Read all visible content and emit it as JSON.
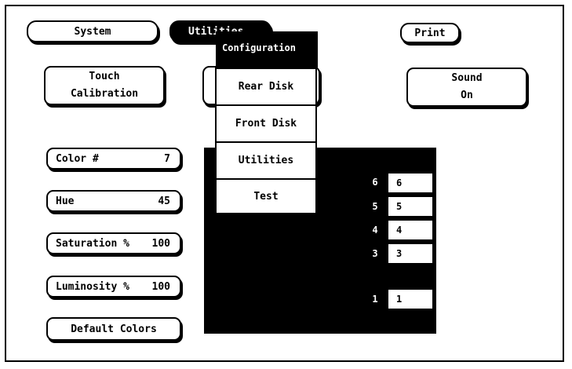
{
  "tabs": {
    "system": "System",
    "utilities": "Utilities",
    "print": "Print"
  },
  "buttons": {
    "touch_calibration": [
      "Touch",
      "Calibration"
    ],
    "rear_disk_hidden": "",
    "sound": [
      "Sound",
      "On"
    ],
    "color": {
      "label": "Color #",
      "value": "7"
    },
    "hue": {
      "label": "Hue",
      "value": "45"
    },
    "saturation": {
      "label": "Saturation %",
      "value": "100"
    },
    "luminosity": {
      "label": "Luminosity %",
      "value": "100"
    },
    "default_colors": "Default Colors"
  },
  "menu": {
    "title": "Configuration",
    "items": [
      "Rear Disk",
      "Front Disk",
      "Utilities",
      "Test"
    ]
  },
  "color_slots": [
    {
      "label": "6",
      "value": "6"
    },
    {
      "label": "5",
      "value": "5"
    },
    {
      "label": "4",
      "value": "4"
    },
    {
      "label": "3",
      "value": "3"
    },
    {
      "label": "1",
      "value": "1"
    }
  ],
  "colors": {
    "background": "#ffffff",
    "foreground": "#000000"
  }
}
